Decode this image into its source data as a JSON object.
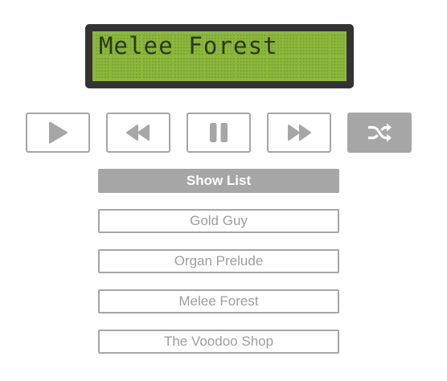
{
  "display": {
    "line1": "Melee Forest",
    "line2": ""
  },
  "controls": [
    {
      "name": "play",
      "icon": "play-icon"
    },
    {
      "name": "rewind",
      "icon": "rewind-icon"
    },
    {
      "name": "pause",
      "icon": "pause-icon"
    },
    {
      "name": "fast-forward",
      "icon": "fast-forward-icon"
    },
    {
      "name": "shuffle",
      "icon": "shuffle-icon",
      "active": true
    }
  ],
  "show_list_label": "Show List",
  "tracks": [
    "Gold Guy",
    "Organ Prelude",
    "Melee Forest",
    "The Voodoo Shop"
  ],
  "colors": {
    "lcd_background": "#8cb83c",
    "lcd_frame": "#333333",
    "button_gray": "#a6a6a6"
  }
}
